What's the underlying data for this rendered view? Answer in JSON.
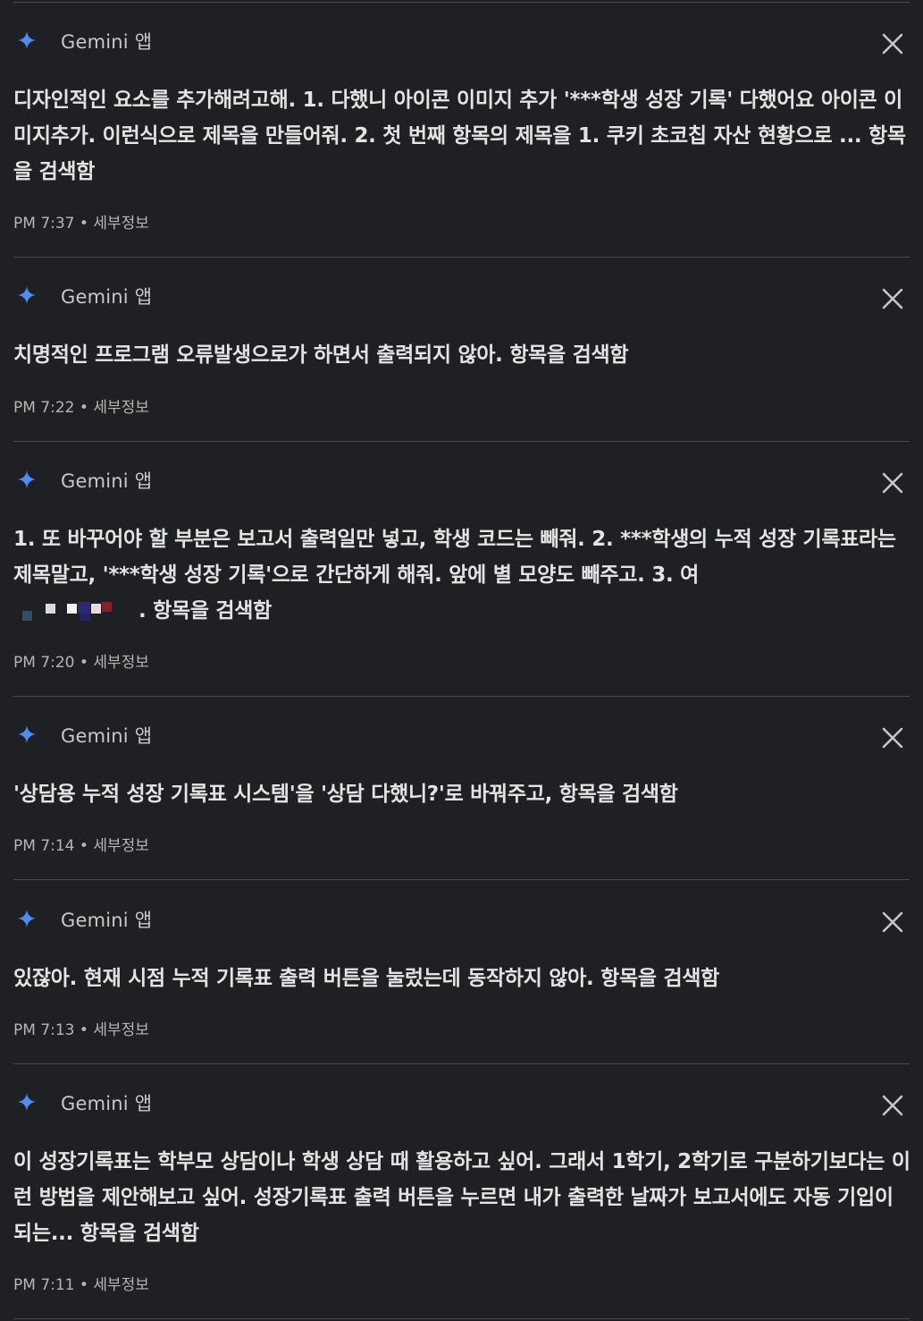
{
  "colors": {
    "background": "#1f2023",
    "spark_blue": "#4c8df6",
    "divider": "#4a4b4e"
  },
  "app_name": "Gemini 앱",
  "entries": [
    {
      "text": "디자인적인 요소를 추가해려고해. 1. 다했니 아이콘 이미지 추가 '***학생 성장 기록' 다했어요 아이콘 이미지추가. 이런식으로 제목을 만들어줘. 2. 첫 번째 항목의 제목을 1. 쿠키 초코칩 자산 현황으로 ... 항목을 검색함",
      "time": "PM 7:37",
      "details": "세부정보"
    },
    {
      "text": "치명적인 프로그램 오류발생으로가 하면서 출력되지 않아. 항목을 검색함",
      "time": "PM 7:22",
      "details": "세부정보"
    },
    {
      "text_before": "1. 또 바꾸어야 할 부분은 보고서 출력일만 넣고, 학생 코드는 빼줘. 2. ***학생의 누적 성장 기록표라는 제목말고, '***학생 성장 기록'으로 간단하게 해줘. 앞에 별 모양도 빼주고. 3. 여",
      "text_after": ". 항목을 검색함",
      "time": "PM 7:20",
      "details": "세부정보"
    },
    {
      "text": "'상담용 누적 성장 기록표 시스템'을 '상담 다했니?'로 바꿔주고, 항목을 검색함",
      "time": "PM 7:14",
      "details": "세부정보"
    },
    {
      "text": "있잖아. 현재 시점 누적 기록표 출력 버튼을 눌렀는데 동작하지 않아. 항목을 검색함",
      "time": "PM 7:13",
      "details": "세부정보"
    },
    {
      "text": "이 성장기록표는 학부모 상담이나 학생 상담 때 활용하고 싶어. 그래서 1학기, 2학기로 구분하기보다는 이런 방법을 제안해보고 싶어. 성장기록표 출력 버튼을 누르면 내가 출력한 날짜가 보고서에도 자동 기입이 되는... 항목을 검색함",
      "time": "PM 7:11",
      "details": "세부정보"
    }
  ]
}
